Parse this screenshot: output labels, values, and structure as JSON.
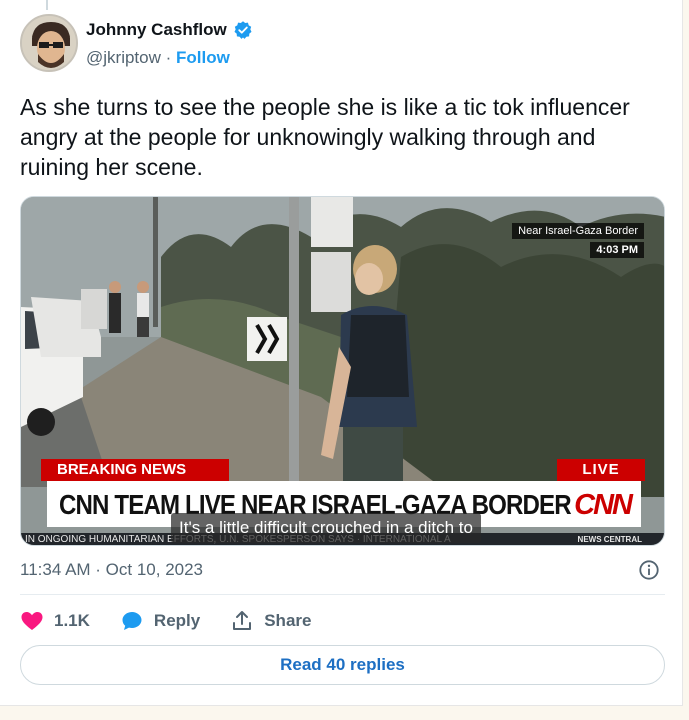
{
  "author": {
    "name": "Johnny Cashflow",
    "handle": "@jkriptow",
    "separator": " · ",
    "follow_label": "Follow",
    "avatar_icon": "avatar-portrait-icon",
    "verified_icon": "verified-badge-icon",
    "verified_color": "#1d9bf0"
  },
  "tweet": {
    "text": "As she turns to see the people she is like a tic tok influencer angry at the people for unknowingly walking through and ruining her scene.",
    "timestamp": "11:34 AM · Oct 10, 2023"
  },
  "media": {
    "location_label": "Near Israel-Gaza Border",
    "time_label": "4:03 PM",
    "breaking_label": "BREAKING NEWS",
    "live_label": "LIVE",
    "headline": "CNN TEAM LIVE NEAR ISRAEL-GAZA BORDER",
    "network_logo": "CNN",
    "ticker_text": "IN ONGOING HUMANITARIAN EFFORTS, U.N. SPOKESPERSON SAYS   ·   INTERNATIONAL A",
    "ticker_right": "NEWS CENTRAL",
    "caption": "It's a little difficult crouched in a ditch to",
    "brand_color": "#cc0000"
  },
  "actions": {
    "like_count": "1.1K",
    "like_icon": "heart-icon",
    "like_color": "#f91880",
    "reply_label": "Reply",
    "reply_icon": "speech-bubble-icon",
    "reply_color": "#1d9bf0",
    "share_label": "Share",
    "share_icon": "share-upload-icon",
    "info_icon": "info-icon"
  },
  "read_replies_label": "Read 40 replies"
}
